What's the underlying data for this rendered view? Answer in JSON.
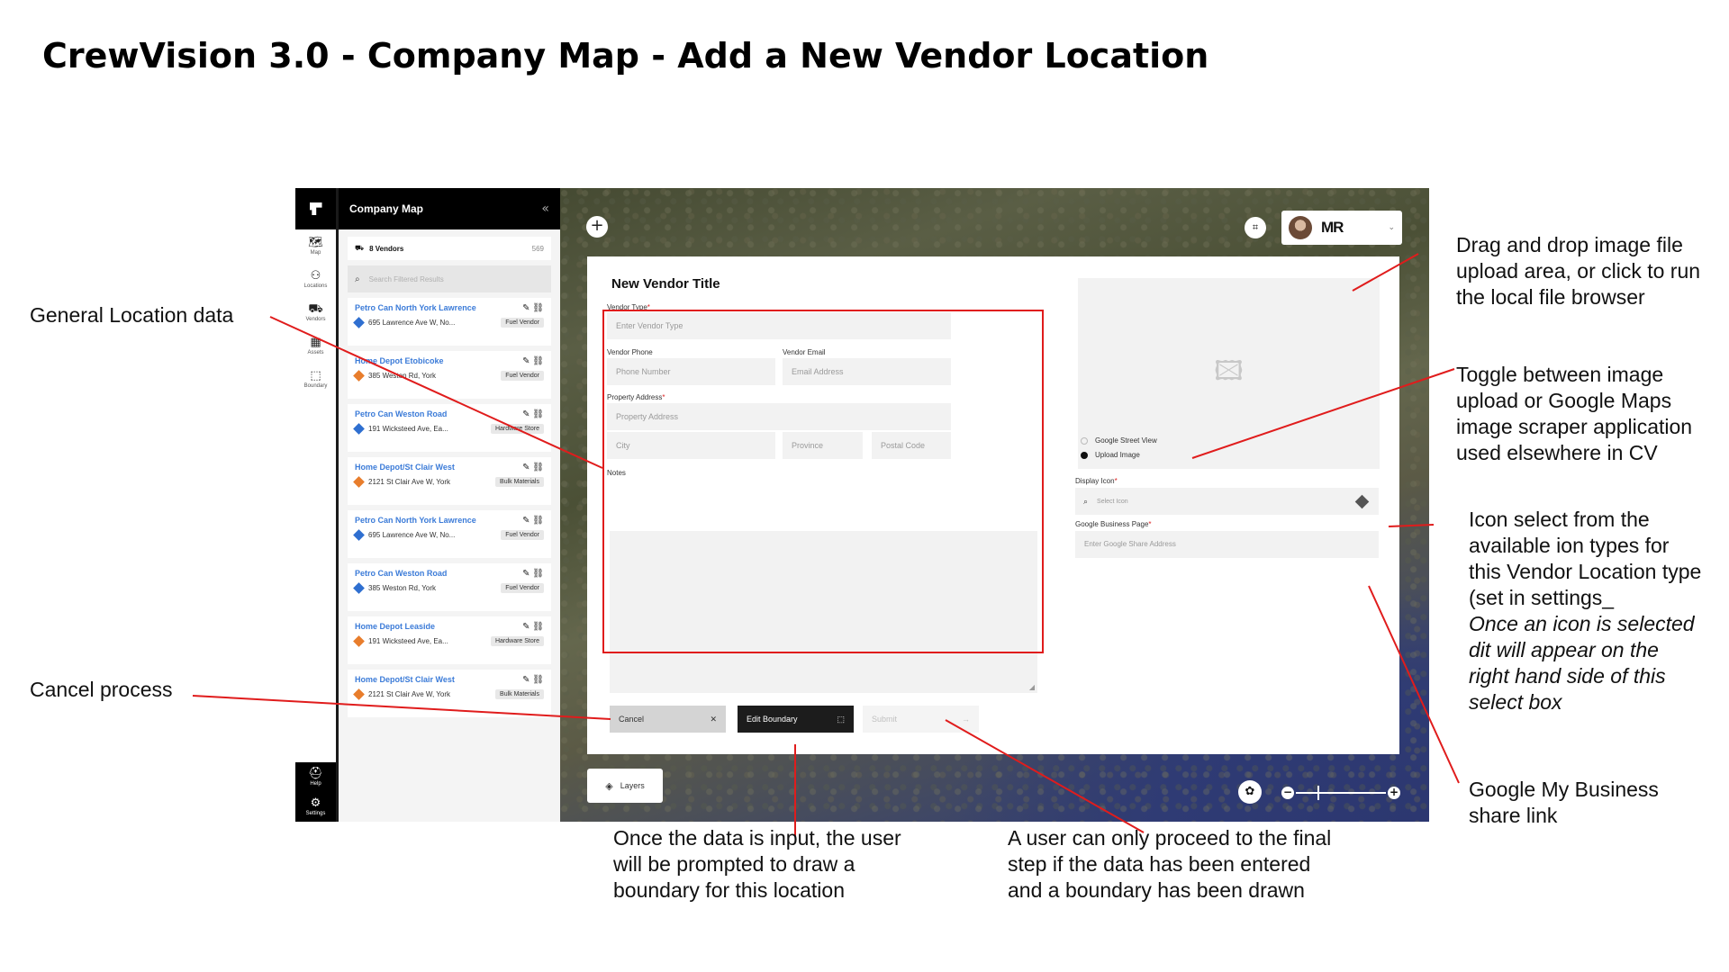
{
  "page_title": "CrewVision 3.0 - Company Map - Add a New Vendor Location",
  "rail": {
    "items": [
      {
        "label": "Map",
        "icon": "map-icon",
        "glyph": "🗺"
      },
      {
        "label": "Locations",
        "icon": "locations-icon",
        "glyph": "⚇"
      },
      {
        "label": "Vendors",
        "icon": "vendors-icon",
        "glyph": "⛟"
      },
      {
        "label": "Assets",
        "icon": "assets-icon",
        "glyph": "▦"
      },
      {
        "label": "Boundary",
        "icon": "boundary-icon",
        "glyph": "⬚"
      }
    ],
    "bottom": [
      {
        "label": "Help",
        "icon": "help-icon",
        "glyph": "⛑"
      },
      {
        "label": "Settings",
        "icon": "settings-icon",
        "glyph": "⚙"
      }
    ]
  },
  "panel": {
    "title": "Company Map",
    "vendor_count_label": "8 Vendors",
    "vendor_count_total": "569",
    "search_placeholder": "Search Filtered Results",
    "vendors": [
      {
        "name": "Petro Can North York Lawrence",
        "address": "695 Lawrence Ave W, No...",
        "tag": "Fuel Vendor",
        "pin": "blue"
      },
      {
        "name": "Home Depot Etobicoke",
        "address": "385 Weston Rd, York",
        "tag": "Fuel Vendor",
        "pin": "orange"
      },
      {
        "name": "Petro Can Weston Road",
        "address": "191 Wicksteed Ave, Ea...",
        "tag": "Hardware Store",
        "pin": "blue"
      },
      {
        "name": "Home Depot/St Clair West",
        "address": "2121 St Clair Ave W, York",
        "tag": "Bulk Materials",
        "pin": "orange"
      },
      {
        "name": "Petro Can North York Lawrence",
        "address": "695 Lawrence Ave W, No...",
        "tag": "Fuel Vendor",
        "pin": "blue"
      },
      {
        "name": "Petro Can Weston Road",
        "address": "385 Weston Rd, York",
        "tag": "Fuel Vendor",
        "pin": "blue"
      },
      {
        "name": "Home Depot Leaside",
        "address": "191 Wicksteed Ave, Ea...",
        "tag": "Hardware Store",
        "pin": "orange"
      },
      {
        "name": "Home Depot/St Clair West",
        "address": "2121 St Clair Ave W, York",
        "tag": "Bulk Materials",
        "pin": "orange"
      }
    ]
  },
  "brand": {
    "name": "MR"
  },
  "modal": {
    "title": "New Vendor Title",
    "vendor_type_label": "Vendor Type",
    "vendor_type_placeholder": "Enter Vendor Type",
    "phone_label": "Vendor Phone",
    "phone_placeholder": "Phone Number",
    "email_label": "Vendor Email",
    "email_placeholder": "Email Address",
    "address_label": "Property Address",
    "address_placeholder": "Property Address",
    "city_placeholder": "City",
    "province_placeholder": "Province",
    "postal_placeholder": "Postal Code",
    "notes_label": "Notes",
    "required_mark": "*",
    "radio_street_view": "Google Street View",
    "radio_upload": "Upload Image",
    "selected_image_source": "Upload Image",
    "display_icon_label": "Display Icon",
    "display_icon_placeholder": "Select Icon",
    "google_page_label": "Google Business Page",
    "google_page_placeholder": "Enter Google Share Address",
    "cancel_label": "Cancel",
    "edit_boundary_label": "Edit Boundary",
    "submit_label": "Submit"
  },
  "map_controls": {
    "layers_label": "Layers"
  },
  "annotations": {
    "general_location": "General Location  data",
    "cancel_process": "Cancel process",
    "drag_drop": [
      "Drag and drop  image file",
      "upload area, or click to run",
      "the local file browser"
    ],
    "toggle": [
      "Toggle between image",
      "upload or Google Maps",
      "image scraper application",
      "used elsewhere in CV"
    ],
    "icon_select": [
      "Icon select from the",
      "available ion types for",
      "this Vendor Location type",
      "(set in settings_"
    ],
    "icon_select_italic": [
      "Once an icon is selected",
      "dit will appear on the",
      "right hand side of this",
      "select box"
    ],
    "google_business": [
      "Google My Business",
      "share link"
    ],
    "boundary_prompt": [
      "Once the data is input, the user",
      "will be prompted to draw a",
      "boundary for this location"
    ],
    "final_step": [
      "A user can only proceed to the final",
      "step if the data has been entered",
      "and a boundary has been drawn"
    ]
  },
  "colors": {
    "annotation_red": "#e01c1c",
    "link_blue": "#3b7bd8",
    "pin_blue": "#2f6fd0",
    "pin_orange": "#e87d2c"
  }
}
